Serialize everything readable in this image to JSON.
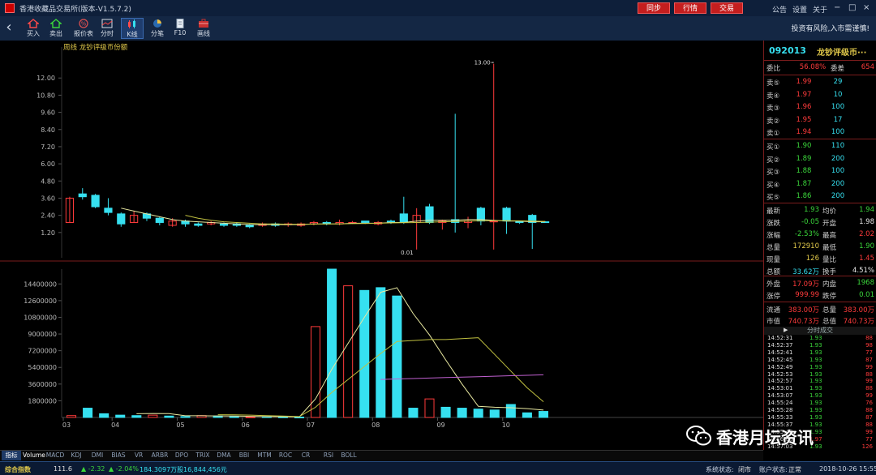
{
  "window": {
    "title": "香港收藏品交易所(版本-V1.5.7.2)",
    "top_buttons": [
      "同步",
      "行情",
      "交易"
    ],
    "menu_links": [
      "公告",
      "设置",
      "关于"
    ],
    "controls": [
      "−",
      "□",
      "×"
    ]
  },
  "toolbar": {
    "items": [
      "买入",
      "卖出",
      "报价表",
      "分时",
      "K线",
      "分笔",
      "F10",
      "画线"
    ],
    "active": "K线",
    "risk_notice": "投资有风险,入市需谨慎!"
  },
  "chart": {
    "title": "周线 龙钞评级币份额"
  },
  "chart_data": [
    {
      "type": "candlestick",
      "yticks": [
        "12.00",
        "10.80",
        "9.60",
        "8.40",
        "7.20",
        "6.00",
        "4.80",
        "3.60",
        "2.40",
        "1.20"
      ],
      "ylim": [
        0,
        13.6
      ],
      "high_label": "13.00",
      "low_label": "0.01",
      "colors": {
        "up": "#ff3b3b",
        "down": "#36e0f0",
        "ma5": "#e8e8a0",
        "ma10": "#c0c040",
        "ma20": "#c060d0"
      },
      "candles": [
        {
          "o": 1.9,
          "c": 3.6,
          "h": 3.7,
          "l": 1.9
        },
        {
          "o": 3.9,
          "c": 3.7,
          "h": 4.3,
          "l": 3.5
        },
        {
          "o": 3.8,
          "c": 3.0,
          "h": 3.9,
          "l": 2.9
        },
        {
          "o": 2.9,
          "c": 2.6,
          "h": 3.6,
          "l": 2.4
        },
        {
          "o": 2.5,
          "c": 1.8,
          "h": 2.6,
          "l": 1.6
        },
        {
          "o": 1.9,
          "c": 2.4,
          "h": 2.7,
          "l": 1.9
        },
        {
          "o": 2.5,
          "c": 2.2,
          "h": 2.6,
          "l": 2.0
        },
        {
          "o": 2.2,
          "c": 1.9,
          "h": 2.3,
          "l": 1.7
        },
        {
          "o": 1.7,
          "c": 2.0,
          "h": 2.2,
          "l": 1.6
        },
        {
          "o": 2.0,
          "c": 1.8,
          "h": 2.1,
          "l": 1.6
        },
        {
          "o": 1.8,
          "c": 1.7,
          "h": 1.9,
          "l": 1.6
        },
        {
          "o": 1.8,
          "c": 1.9,
          "h": 2.0,
          "l": 1.7
        },
        {
          "o": 1.8,
          "c": 1.7,
          "h": 1.9,
          "l": 1.6
        },
        {
          "o": 1.8,
          "c": 1.7,
          "h": 1.9,
          "l": 1.6
        },
        {
          "o": 1.7,
          "c": 1.6,
          "h": 1.8,
          "l": 1.5
        },
        {
          "o": 1.7,
          "c": 1.8,
          "h": 1.9,
          "l": 1.6
        },
        {
          "o": 1.8,
          "c": 1.7,
          "h": 1.9,
          "l": 1.6
        },
        {
          "o": 1.8,
          "c": 1.8,
          "h": 1.9,
          "l": 1.6
        },
        {
          "o": 1.7,
          "c": 1.8,
          "h": 1.9,
          "l": 1.6
        },
        {
          "o": 1.8,
          "c": 1.9,
          "h": 2.0,
          "l": 1.7
        },
        {
          "o": 1.9,
          "c": 1.8,
          "h": 2.0,
          "l": 1.7
        },
        {
          "o": 1.8,
          "c": 1.9,
          "h": 2.1,
          "l": 1.7
        },
        {
          "o": 1.9,
          "c": 1.9,
          "h": 2.0,
          "l": 1.8
        },
        {
          "o": 2.0,
          "c": 1.9,
          "h": 2.0,
          "l": 1.8
        },
        {
          "o": 1.8,
          "c": 1.9,
          "h": 2.0,
          "l": 1.7
        },
        {
          "o": 2.0,
          "c": 1.9,
          "h": 2.1,
          "l": 1.8
        },
        {
          "o": 2.5,
          "c": 1.9,
          "h": 3.7,
          "l": 1.8
        },
        {
          "o": 1.9,
          "c": 2.4,
          "h": 2.9,
          "l": 0.01
        },
        {
          "o": 3.0,
          "c": 1.9,
          "h": 3.2,
          "l": 1.8
        },
        {
          "o": 1.9,
          "c": 2.0,
          "h": 2.1,
          "l": 1.4
        },
        {
          "o": 2.1,
          "c": 1.9,
          "h": 9.5,
          "l": 1.2
        },
        {
          "o": 1.9,
          "c": 2.0,
          "h": 2.3,
          "l": 1.5
        },
        {
          "o": 2.9,
          "c": 2.0,
          "h": 3.0,
          "l": 1.7
        },
        {
          "o": 2.0,
          "c": 2.0,
          "h": 13.0,
          "l": 0.01
        },
        {
          "o": 2.9,
          "c": 2.0,
          "h": 3.0,
          "l": 1.1
        },
        {
          "o": 2.0,
          "c": 1.9,
          "h": 2.0,
          "l": 1.8
        },
        {
          "o": 2.4,
          "c": 1.9,
          "h": 2.5,
          "l": 0.05
        },
        {
          "o": 1.95,
          "c": 1.93,
          "h": 2.0,
          "l": 1.9
        }
      ],
      "ma": {
        "ma5": [
          null,
          null,
          null,
          null,
          2.9,
          2.7,
          2.5,
          2.3,
          2.1,
          2.0,
          1.95,
          1.9,
          1.85,
          1.8,
          1.75,
          1.75,
          1.75,
          1.75,
          1.75,
          1.8,
          1.8,
          1.8,
          1.85,
          1.85,
          1.85,
          1.9,
          1.9,
          2.0,
          2.05,
          2.05,
          2.05,
          2.1,
          2.1,
          2.05,
          2.0,
          2.0,
          1.95,
          1.95
        ],
        "ma10": [
          null,
          null,
          null,
          null,
          null,
          null,
          null,
          null,
          null,
          2.4,
          2.2,
          2.05,
          1.95,
          1.9,
          1.85,
          1.8,
          1.8,
          1.78,
          1.78,
          1.78,
          1.8,
          1.8,
          1.82,
          1.83,
          1.85,
          1.87,
          1.88,
          1.9,
          1.92,
          1.95,
          1.97,
          2.0,
          2.02,
          2.03,
          2.03,
          2.02,
          2.0,
          1.98
        ]
      }
    },
    {
      "type": "bar",
      "yticks": [
        "14400000",
        "12600000",
        "10800000",
        "9000000",
        "7200000",
        "5400000",
        "3600000",
        "1800000"
      ],
      "ylim": [
        0,
        16000000
      ],
      "xticks": [
        "03",
        "04",
        "05",
        "06",
        "07",
        "08",
        "09",
        "10"
      ],
      "bars": [
        {
          "v": 200000,
          "up": true
        },
        {
          "v": 1000000,
          "up": false
        },
        {
          "v": 400000,
          "up": false
        },
        {
          "v": 250000,
          "up": false
        },
        {
          "v": 200000,
          "up": false
        },
        {
          "v": 250000,
          "up": true
        },
        {
          "v": 150000,
          "up": false
        },
        {
          "v": 100000,
          "up": false
        },
        {
          "v": 200000,
          "up": true
        },
        {
          "v": 150000,
          "up": false
        },
        {
          "v": 80000,
          "up": false
        },
        {
          "v": 60000,
          "up": true
        },
        {
          "v": 80000,
          "up": false
        },
        {
          "v": 60000,
          "up": false
        },
        {
          "v": 40000,
          "up": false
        },
        {
          "v": 9800000,
          "up": true
        },
        {
          "v": 16000000,
          "up": false
        },
        {
          "v": 14200000,
          "up": true
        },
        {
          "v": 13700000,
          "up": false
        },
        {
          "v": 14000000,
          "up": false
        },
        {
          "v": 13100000,
          "up": false
        },
        {
          "v": 1000000,
          "up": false
        },
        {
          "v": 2000000,
          "up": true
        },
        {
          "v": 1100000,
          "up": false
        },
        {
          "v": 1000000,
          "up": false
        },
        {
          "v": 900000,
          "up": false
        },
        {
          "v": 800000,
          "up": false
        },
        {
          "v": 1400000,
          "up": false
        },
        {
          "v": 500000,
          "up": false
        },
        {
          "v": 650000,
          "up": false
        }
      ],
      "ma": {
        "ma5": [
          null,
          null,
          null,
          null,
          400000,
          430000,
          410000,
          180000,
          180000,
          170000,
          150000,
          120000,
          100000,
          90000,
          60000,
          2000000,
          5200000,
          8000000,
          10800000,
          13500000,
          14000000,
          11200000,
          8900000,
          6200000,
          3600000,
          1200000,
          1100000,
          1050000,
          950000,
          800000
        ],
        "ma10": [
          null,
          null,
          null,
          null,
          null,
          null,
          null,
          null,
          null,
          300000,
          280000,
          250000,
          200000,
          150000,
          100000,
          1100000,
          2700000,
          4100000,
          5500000,
          6900000,
          8200000,
          8300000,
          8400000,
          8400000,
          8500000,
          8600000,
          6800000,
          5000000,
          3200000,
          1700000
        ],
        "ma20": [
          null,
          null,
          null,
          null,
          null,
          null,
          null,
          null,
          null,
          null,
          null,
          null,
          null,
          null,
          null,
          null,
          null,
          null,
          null,
          4100000,
          4150000,
          4200000,
          4250000,
          4300000,
          4350000,
          4400000,
          4450000,
          4500000,
          4550000,
          4600000
        ]
      }
    }
  ],
  "side": {
    "code": "092013",
    "name": "龙钞评级币···",
    "weibi": {
      "l": "委比",
      "v": "56.08%",
      "l2": "委差",
      "v2": "654"
    },
    "asks": [
      {
        "l": "卖⑤",
        "p": "1.99",
        "v": "29"
      },
      {
        "l": "卖④",
        "p": "1.97",
        "v": "10"
      },
      {
        "l": "卖③",
        "p": "1.96",
        "v": "100"
      },
      {
        "l": "卖②",
        "p": "1.95",
        "v": "17"
      },
      {
        "l": "卖①",
        "p": "1.94",
        "v": "100"
      }
    ],
    "bids": [
      {
        "l": "买①",
        "p": "1.90",
        "v": "110"
      },
      {
        "l": "买②",
        "p": "1.89",
        "v": "200"
      },
      {
        "l": "买③",
        "p": "1.88",
        "v": "100"
      },
      {
        "l": "买④",
        "p": "1.87",
        "v": "200"
      },
      {
        "l": "买⑤",
        "p": "1.86",
        "v": "200"
      }
    ],
    "stats": [
      {
        "l": "最新",
        "v": "1.93",
        "c": "green",
        "l2": "均价",
        "v2": "1.94",
        "c2": "green"
      },
      {
        "l": "涨跌",
        "v": "-0.05",
        "c": "green",
        "l2": "开盘",
        "v2": "1.98",
        "c2": "white"
      },
      {
        "l": "涨幅",
        "v": "-2.53%",
        "c": "green",
        "l2": "最高",
        "v2": "2.02",
        "c2": "red"
      },
      {
        "l": "总量",
        "v": "172910",
        "c": "yellow",
        "l2": "最低",
        "v2": "1.90",
        "c2": "green"
      },
      {
        "l": "现量",
        "v": "126",
        "c": "yellow",
        "l2": "量比",
        "v2": "1.45",
        "c2": "red"
      },
      {
        "l": "总额",
        "v": "33.62万",
        "c": "cyan",
        "l2": "换手",
        "v2": "4.51%",
        "c2": "white"
      }
    ],
    "stats2": [
      {
        "l": "外盘",
        "v": "17.09万",
        "c": "red",
        "l2": "内盘",
        "v2": "1968",
        "c2": "green"
      },
      {
        "l": "涨停",
        "v": "999.99",
        "c": "red",
        "l2": "跌停",
        "v2": "0.01",
        "c2": "green"
      }
    ],
    "stats3": [
      {
        "l": "流通",
        "v": "383.00万",
        "c": "red",
        "l2": "总量",
        "v2": "383.00万",
        "c2": "red"
      },
      {
        "l": "市值",
        "v": "740.73万",
        "c": "red",
        "l2": "总值",
        "v2": "740.73万",
        "c2": "red"
      }
    ],
    "ticks_header": "分时成交",
    "ticks": [
      {
        "t": "14:52:31",
        "p": "1.93",
        "v": "88"
      },
      {
        "t": "14:52:37",
        "p": "1.93",
        "v": "98"
      },
      {
        "t": "14:52:41",
        "p": "1.93",
        "v": "77"
      },
      {
        "t": "14:52:45",
        "p": "1.93",
        "v": "87"
      },
      {
        "t": "14:52:49",
        "p": "1.93",
        "v": "99"
      },
      {
        "t": "14:52:53",
        "p": "1.93",
        "v": "88"
      },
      {
        "t": "14:52:57",
        "p": "1.93",
        "v": "99"
      },
      {
        "t": "14:53:01",
        "p": "1.93",
        "v": "88"
      },
      {
        "t": "14:53:07",
        "p": "1.93",
        "v": "99"
      },
      {
        "t": "14:55:24",
        "p": "1.93",
        "v": "76"
      },
      {
        "t": "14:55:28",
        "p": "1.93",
        "v": "88"
      },
      {
        "t": "14:55:33",
        "p": "1.93",
        "v": "87"
      },
      {
        "t": "14:55:37",
        "p": "1.93",
        "v": "88"
      },
      {
        "t": "14:55:43",
        "p": "1.93",
        "v": "99"
      },
      {
        "t": "14:56:06",
        "p": "1.97",
        "v": "77"
      },
      {
        "t": "14:57:03",
        "p": "1.93",
        "v": "126"
      }
    ]
  },
  "tabs": [
    "指标",
    "Volume",
    "MACD",
    "KDJ",
    "DMI",
    "BIAS",
    "VR",
    "ARBR",
    "DPO",
    "TRIX",
    "DMA",
    "BBI",
    "MTM",
    "ROC",
    "CR",
    "RSI",
    "BOLL"
  ],
  "status": {
    "index_label": "综合指数",
    "index_value": "111.6",
    "change": "▲ -2.32",
    "change_pct": "▲ -2.04%",
    "volume": "184.3097万股",
    "amount": "16,844,456元",
    "sys_label": "系统状态:",
    "sys_value": "闭市",
    "acct_label": "账户状态:",
    "acct_value": "正常",
    "datetime": "2018-10-26 15:55:38"
  },
  "watermark": {
    "text": "香港月坛资讯",
    "icon": "wechat-logo-icon"
  }
}
